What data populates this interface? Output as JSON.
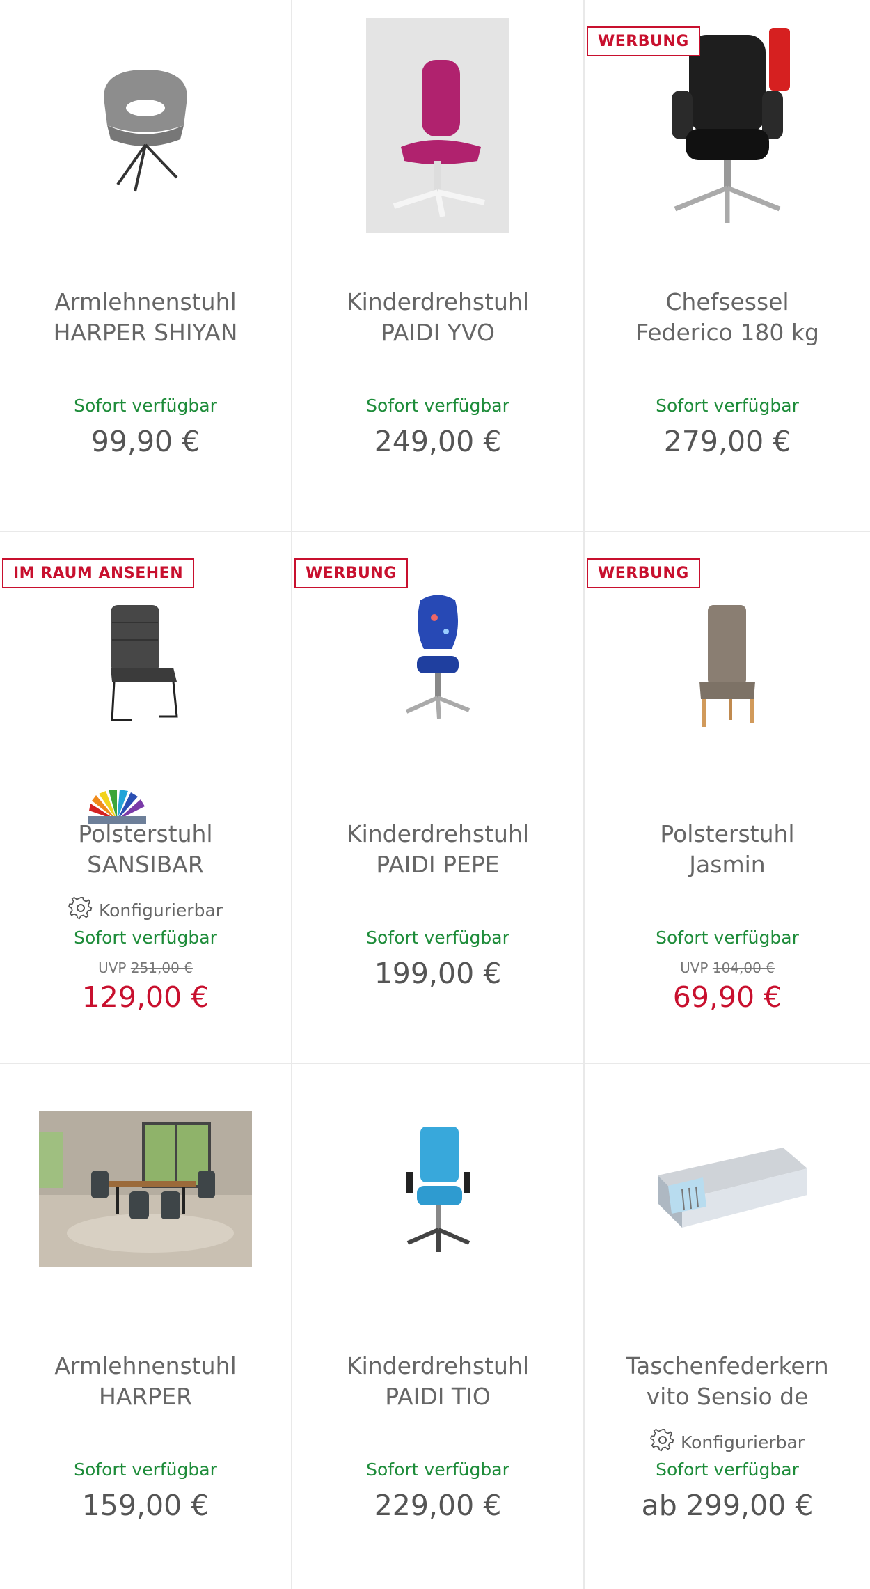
{
  "colors": {
    "accent_red": "#c8102e",
    "available_green": "#1e8c3a",
    "divider": "#e9e9e9"
  },
  "products": [
    {
      "title_line1": "Armlehnenstuhl",
      "title_line2": "HARPER SHIYAN",
      "availability": "Sofort verfügbar",
      "price": "99,90 €",
      "image_icon": "armchair-grey-image"
    },
    {
      "title_line1": "Kinderdrehstuhl",
      "title_line2": "PAIDI YVO",
      "availability": "Sofort verfügbar",
      "price": "249,00 €",
      "image_icon": "kids-swivel-chair-pink-image"
    },
    {
      "badge": "WERBUNG",
      "title_line1": "Chefsessel",
      "title_line2": "Federico 180 kg",
      "availability": "Sofort verfügbar",
      "price": "279,00 €",
      "image_icon": "executive-chair-black-image"
    },
    {
      "badge": "IM RAUM ANSEHEN",
      "title_line1": "Polsterstuhl",
      "title_line2": "SANSIBAR",
      "configurable": "Konfigurierbar",
      "availability": "Sofort verfügbar",
      "uvp_label": "UVP",
      "uvp_price": "251,00 €",
      "price": "129,00 €",
      "image_icon": "upholstered-chair-anthracite-image",
      "swatch_icon": "color-fan-icon"
    },
    {
      "badge": "WERBUNG",
      "title_line1": "Kinderdrehstuhl",
      "title_line2": "PAIDI PEPE",
      "availability": "Sofort verfügbar",
      "price": "199,00 €",
      "image_icon": "kids-swivel-chair-blue-image"
    },
    {
      "badge": "WERBUNG",
      "title_line1": "Polsterstuhl",
      "title_line2": "Jasmin",
      "availability": "Sofort verfügbar",
      "uvp_label": "UVP",
      "uvp_price": "104,00 €",
      "price": "69,90 €",
      "image_icon": "dining-chair-taupe-image"
    },
    {
      "title_line1": "Armlehnenstuhl",
      "title_line2": "HARPER",
      "availability": "Sofort verfügbar",
      "price": "159,00 €",
      "image_icon": "dining-room-scene-image"
    },
    {
      "title_line1": "Kinderdrehstuhl",
      "title_line2": "PAIDI TIO",
      "availability": "Sofort verfügbar",
      "price": "229,00 €",
      "image_icon": "office-chair-turquoise-image"
    },
    {
      "title_line1": "Taschenfederkern",
      "title_line2": "vito Sensio de",
      "configurable": "Konfigurierbar",
      "availability": "Sofort verfügbar",
      "price": "ab 299,00 €",
      "image_icon": "mattress-image"
    }
  ]
}
